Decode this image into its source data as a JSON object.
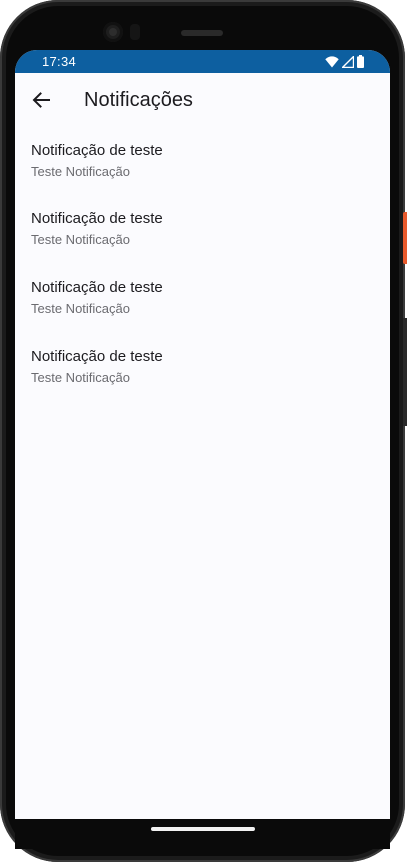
{
  "status_bar": {
    "time": "17:34",
    "icons": [
      "wifi-icon",
      "signal-icon",
      "battery-icon"
    ],
    "background_color": "#0d5fa0"
  },
  "app_bar": {
    "back_icon": "arrow-back-icon",
    "title": "Notificações"
  },
  "notifications": [
    {
      "title": "Notificação de teste",
      "subtitle": "Teste Notificação"
    },
    {
      "title": "Notificação de teste",
      "subtitle": "Teste Notificação"
    },
    {
      "title": "Notificação de teste",
      "subtitle": "Teste Notificação"
    },
    {
      "title": "Notificação de teste",
      "subtitle": "Teste Notificação"
    }
  ]
}
